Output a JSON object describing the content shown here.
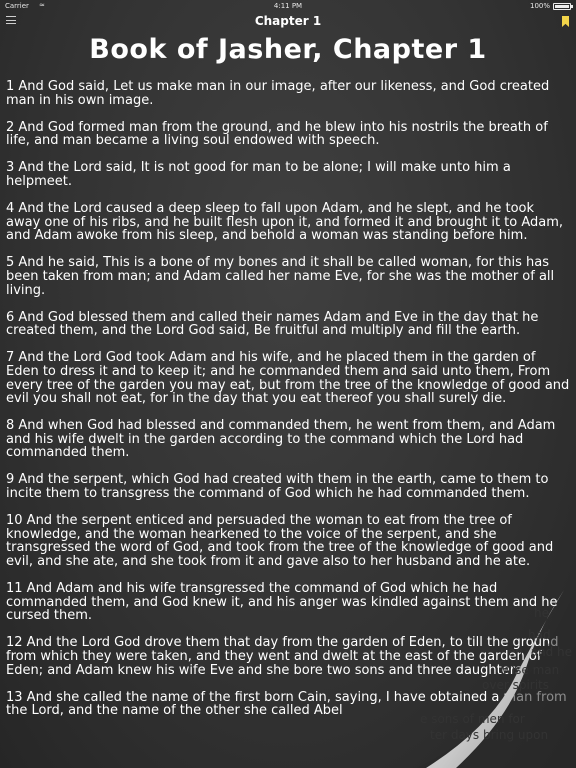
{
  "status": {
    "carrier": "Carrier",
    "wifi_icon": "wifi-icon",
    "time": "4:11 PM",
    "battery": "100%"
  },
  "nav": {
    "title": "Chapter 1",
    "menu_icon": "hamburger-menu-icon",
    "bookmark_icon": "bookmark-icon",
    "bookmark_color": "#f2d44a"
  },
  "page": {
    "heading": "Book of Jasher, Chapter 1",
    "background_color": "#333333",
    "text_color": "#ffffff"
  },
  "verses": [
    "1 And God said, Let us make man in our image, after our likeness, and God created man in his own image.",
    "2 And God formed man from the ground, and he blew into his nostrils the breath of life, and man became a living soul endowed with speech.",
    "3 And the Lord said, It is not good for man to be alone; I will make unto him a helpmeet.",
    "4 And the Lord caused a deep sleep to fall upon Adam, and he slept, and he took away one of his ribs, and he built flesh upon it, and formed it and brought it to Adam, and Adam awoke from his sleep, and behold a woman was standing before him.",
    "5 And he said, This is a bone of my bones and it shall be called woman, for this has been taken from man; and Adam called her name Eve, for she was the mother of all living.",
    "6 And God blessed them and called their names Adam and Eve in the day that he created them, and the Lord God said, Be fruitful and multiply and fill the earth.",
    "7 And the Lord God took Adam and his wife, and he placed them in the garden of Eden to dress it and to keep it; and he commanded them and said unto them, From every tree of the garden you may eat, but from the tree of the knowledge of good and evil you shall not eat, for in the day that you eat thereof you shall surely die.",
    "8 And when God had blessed and commanded them, he went from them, and Adam and his wife dwelt in the garden according to the command which the Lord had commanded them.",
    "9 And the serpent, which God had created with them in the earth, came to them to incite them to transgress the command of God which he had commanded them.",
    "10 And the serpent enticed and persuaded the woman to eat from the tree of knowledge, and the woman hearkened to the voice of the serpent, and she transgressed the word of God, and took from the tree of the knowledge of good and evil, and she ate, and she took from it and gave also to her husband and he ate.",
    "11 And Adam and his wife transgressed the command of God which he had commanded them, and God knew it, and his anger was kindled against them and he cursed them.",
    "12 And the Lord God drove them that day from the garden of Eden, to till the ground from which they were taken, and they went and dwelt at the east of the garden of Eden; and Adam knew his wife Eve and she bore two sons and three daughters.",
    "13 And she called the name of the first born Cain, saying, I have obtained a man from the Lord, and the name of the other she called Abel"
  ],
  "page_curl": {
    "back_text": [
      "he",
      "had",
      "en, and he",
      "wise man",
      "over spirits",
      "e sons of men for",
      "ter days bring upon",
      "I",
      "Abel"
    ]
  }
}
